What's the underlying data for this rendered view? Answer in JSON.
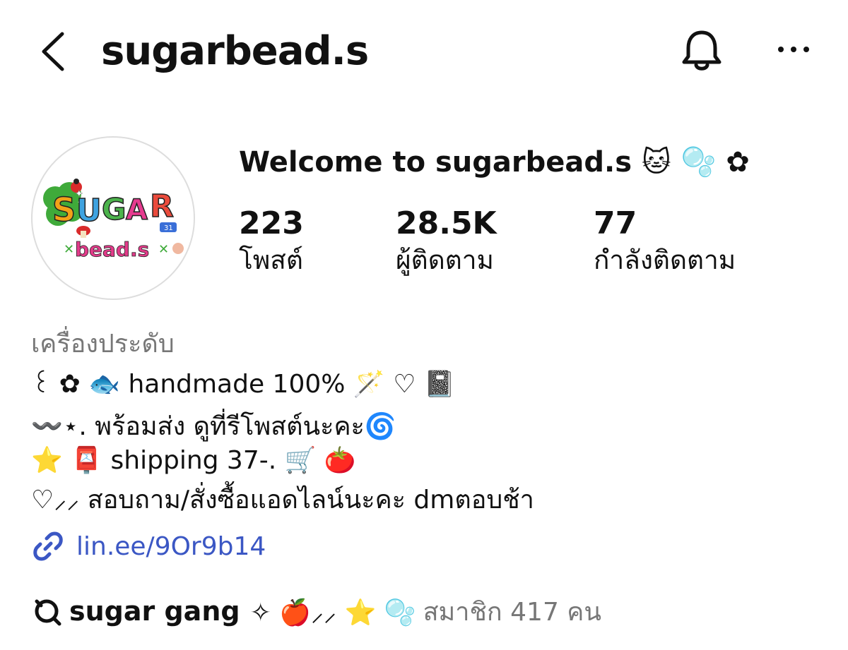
{
  "header": {
    "handle": "sugarbead.s",
    "back_icon": "chevron-left-icon",
    "bell_icon": "bell-icon",
    "more_icon": "ellipsis-icon"
  },
  "profile": {
    "avatar_text_top": "SUGAR",
    "avatar_text_bottom": "bead.s",
    "display_name": "Welcome to sugarbead.s 🐱 🫧 ✿",
    "stats": [
      {
        "value": "223",
        "label": "โพสต์"
      },
      {
        "value": "28.5K",
        "label": "ผู้ติดตาม"
      },
      {
        "value": "77",
        "label": "กำลังติดตาม"
      }
    ]
  },
  "bio": {
    "category": "เครื่องประดับ",
    "lines": [
      "꒰ ✿ 🐟 handmade 100% 🪄 ♡ 📓",
      "〰️⋆. พร้อมส่ง ดูที่รีโพสต์นะคะ🌀",
      "⭐ 📮 shipping 37-. 🛒 🍅",
      "♡⸝⸝ สอบถาม/สั่งซื้อแอดไลน์นะคะ dmตอบช้า"
    ],
    "link": "lin.ee/9Or9b14"
  },
  "channel": {
    "name": "sugar gang",
    "decoration": "✧ 🍎⸝⸝ ⭐ 🫧",
    "members": "สมาชิก 417 คน"
  },
  "colors": {
    "link": "#3b57c4",
    "muted": "#777777",
    "text": "#111111"
  }
}
